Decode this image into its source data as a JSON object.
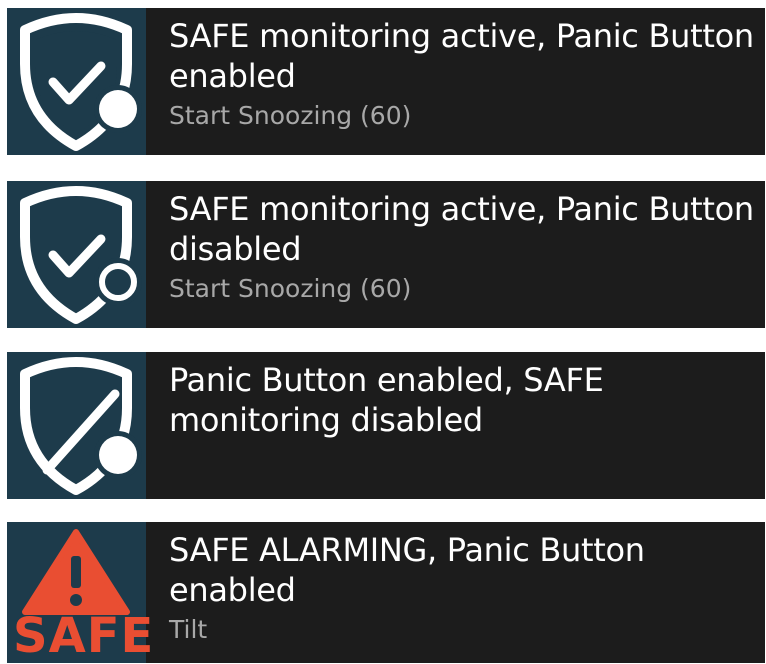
{
  "colors": {
    "background": "#ffffff",
    "notification_bg": "#1c1c1c",
    "icon_bg": "#1d3b4b",
    "title_text": "#ffffff",
    "subtitle_text": "#a8a8a8",
    "alarm_accent": "#e94e32"
  },
  "notifications": [
    {
      "icon": "shield-check-dot-filled-icon",
      "title": "SAFE monitoring active, Panic Button enabled",
      "subtitle": "Start Snoozing (60)"
    },
    {
      "icon": "shield-check-dot-outline-icon",
      "title": "SAFE monitoring active, Panic Button disabled",
      "subtitle": "Start Snoozing (60)"
    },
    {
      "icon": "shield-slash-dot-filled-icon",
      "title": "Panic Button enabled, SAFE monitoring disabled",
      "subtitle": ""
    },
    {
      "icon": "alarm-warning-triangle-icon",
      "icon_text": "SAFE",
      "title": "SAFE ALARMING, Panic Button enabled",
      "subtitle": "Tilt"
    }
  ]
}
